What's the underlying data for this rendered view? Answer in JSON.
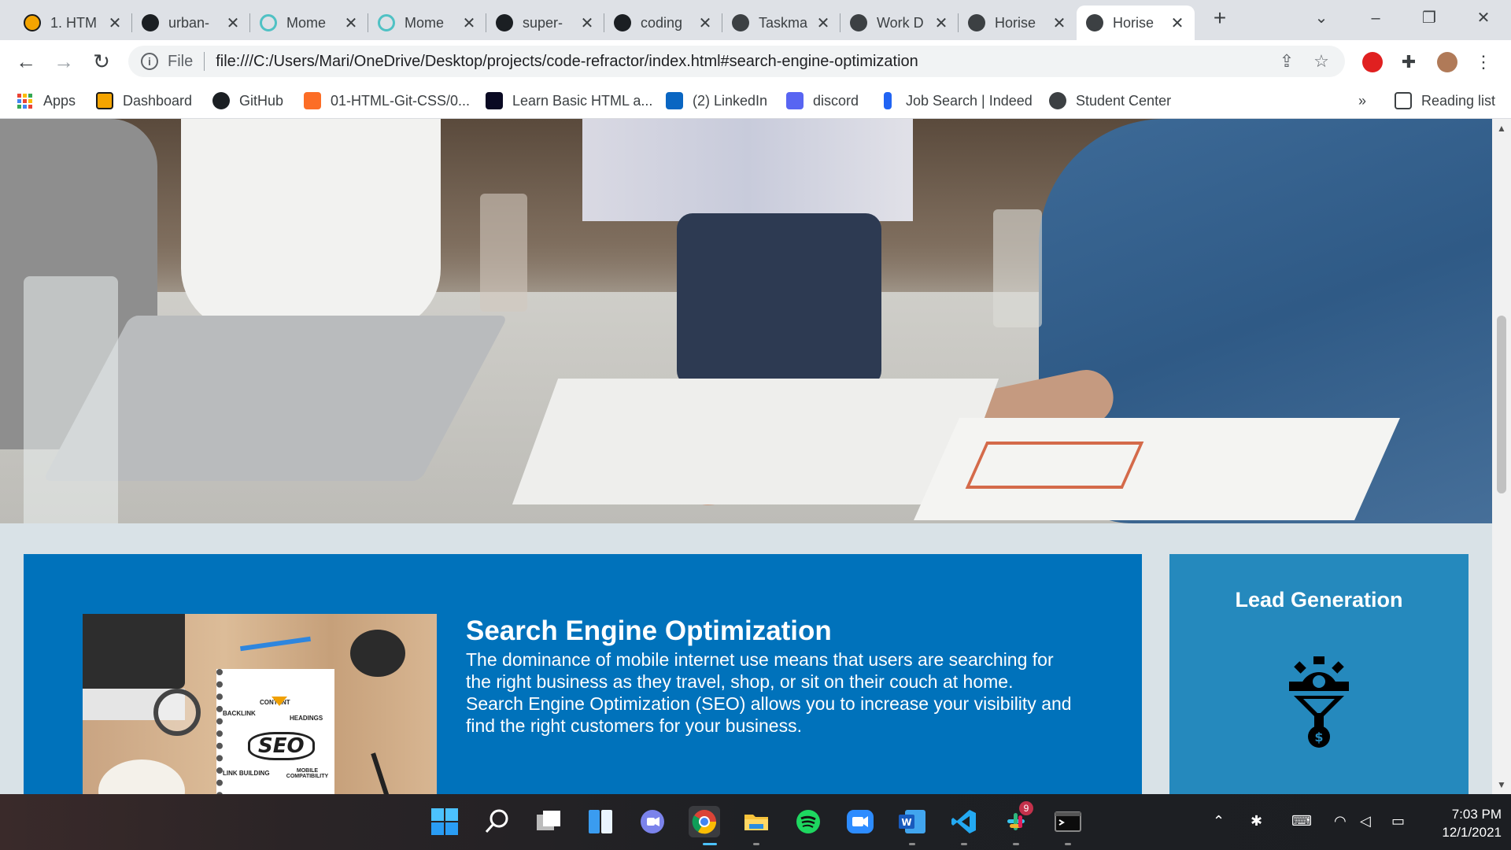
{
  "browser": {
    "tabs": [
      {
        "label": "1. HTM",
        "favicon": "orange-badge-icon",
        "active": false
      },
      {
        "label": "urban-",
        "favicon": "github-icon",
        "active": false
      },
      {
        "label": "Mome",
        "favicon": "ring-icon",
        "active": false
      },
      {
        "label": "Mome",
        "favicon": "ring-icon",
        "active": false
      },
      {
        "label": "super-",
        "favicon": "github-icon",
        "active": false
      },
      {
        "label": "coding",
        "favicon": "github-icon",
        "active": false
      },
      {
        "label": "Taskma",
        "favicon": "globe-icon",
        "active": false
      },
      {
        "label": "Work D",
        "favicon": "globe-icon",
        "active": false
      },
      {
        "label": "Horise",
        "favicon": "globe-icon",
        "active": false
      },
      {
        "label": "Horise",
        "favicon": "globe-icon",
        "active": true
      }
    ],
    "close_glyph": "✕",
    "new_tab_glyph": "+",
    "omnibox": {
      "scheme_label": "File",
      "url": "file:///C:/Users/Mari/OneDrive/Desktop/projects/code-refractor/index.html#search-engine-optimization"
    },
    "bookmarks": [
      {
        "label": "Apps",
        "icon": "apps-grid-icon"
      },
      {
        "label": "Dashboard",
        "icon": "dashboard-icon"
      },
      {
        "label": "GitHub",
        "icon": "github-icon"
      },
      {
        "label": "01-HTML-Git-CSS/0...",
        "icon": "gitlab-icon"
      },
      {
        "label": "Learn Basic HTML a...",
        "icon": "freecodecamp-icon"
      },
      {
        "label": "(2) LinkedIn",
        "icon": "linkedin-icon"
      },
      {
        "label": "discord",
        "icon": "discord-icon"
      },
      {
        "label": "Job Search | Indeed",
        "icon": "indeed-icon"
      },
      {
        "label": "Student Center",
        "icon": "globe-icon"
      }
    ],
    "bookmarks_overflow": "»",
    "reading_list": "Reading list"
  },
  "page": {
    "seo": {
      "title": "Search Engine Optimization",
      "text": "The dominance of mobile internet use means that users are searching for the right business as they travel, shop, or sit on their couch at home. Search Engine Optimization (SEO) allows you to increase your visibility and find the right customers for your business.",
      "image_words": {
        "seo": "SEO",
        "content": "CONTENT",
        "backlink": "BACKLINK",
        "headings": "HEADINGS",
        "link_building": "LINK BUILDING",
        "mobile": "MOBILE COMPATIBILITY"
      }
    },
    "aside": {
      "title": "Lead Generation",
      "icon": "lead-generation-funnel-icon"
    }
  },
  "taskbar": {
    "apps": [
      "windows-start-icon",
      "search-icon",
      "task-view-icon",
      "widgets-icon",
      "teams-chat-icon",
      "chrome-icon",
      "file-explorer-icon",
      "spotify-icon",
      "zoom-icon",
      "word-icon",
      "vscode-icon",
      "slack-icon",
      "terminal-icon"
    ],
    "slack_badge": "9",
    "clock": {
      "time": "7:03 PM",
      "date": "12/1/2021"
    }
  },
  "colors": {
    "content_bg": "#0072bb",
    "aside_bg": "#2589bd",
    "page_bg": "#d9e2e7"
  }
}
